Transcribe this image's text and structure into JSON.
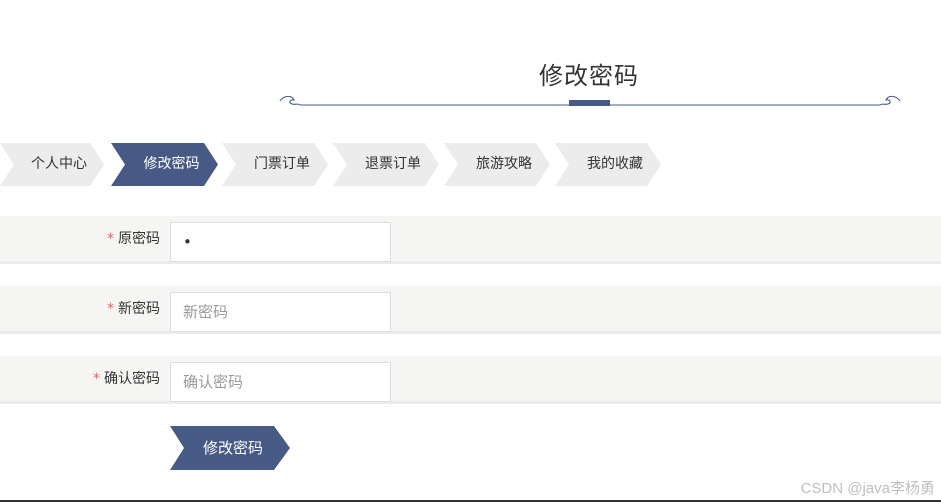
{
  "page": {
    "title": "修改密码"
  },
  "tabs": [
    {
      "label": "个人中心",
      "active": false
    },
    {
      "label": "修改密码",
      "active": true
    },
    {
      "label": "门票订单",
      "active": false
    },
    {
      "label": "退票订单",
      "active": false
    },
    {
      "label": "旅游攻略",
      "active": false
    },
    {
      "label": "我的收藏",
      "active": false
    }
  ],
  "form": {
    "required_mark": "*",
    "old_password": {
      "label": "原密码",
      "value": "•",
      "placeholder": ""
    },
    "new_password": {
      "label": "新密码",
      "value": "",
      "placeholder": "新密码"
    },
    "confirm_password": {
      "label": "确认密码",
      "value": "",
      "placeholder": "确认密码"
    },
    "submit_label": "修改密码"
  },
  "watermark": "CSDN @java李杨勇",
  "colors": {
    "accent": "#475a86",
    "tab_bg": "#ececec",
    "row_bg": "#f5f5f4",
    "required": "#e06a6a"
  }
}
